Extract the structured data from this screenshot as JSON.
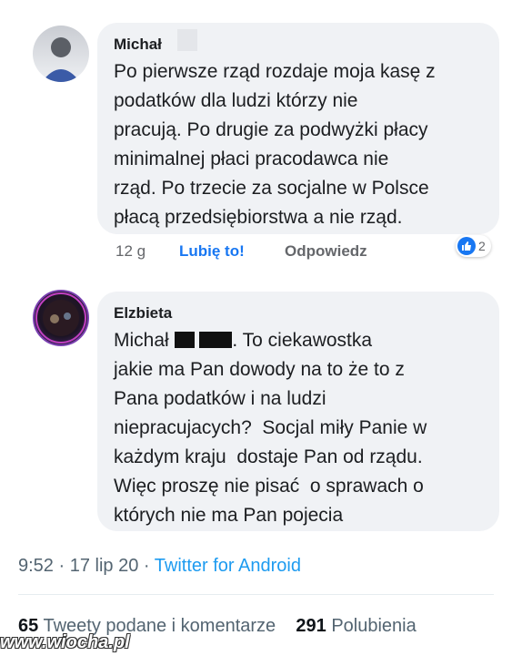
{
  "comment1": {
    "author": "Michał",
    "text": "Po pierwsze rząd rozdaje moja kasę z\npodatków dla ludzi którzy nie\npracują. Po drugie za podwyżki płacy\nminimalnej płaci pracodawca nie\nrząd. Po trzecie za socjalne w Polsce\npłacą przedsiębiorstwa a nie rząd.",
    "time": "12 g",
    "like_label": "Lubię to!",
    "reply_label": "Odpowiedz",
    "reaction_count": "2"
  },
  "comment2": {
    "author": "Elzbieta",
    "mention": "Michał",
    "text_after_mention": ". To ciekawostka\njakie ma Pan dowody na to że to z\nPana podatków i na ludzi\nniepracujacych?  Socjal miły Panie w\nkażdym kraju  dostaje Pan od rządu.\nWięc proszę nie pisać  o sprawach o\nktórych nie ma Pan pojecia"
  },
  "tweet_meta": {
    "time": "9:52",
    "date": "17 lip 20",
    "separator": " · ",
    "source": "Twitter for Android"
  },
  "stats": {
    "retweets_count": "65",
    "retweets_label": "Tweety podane i komentarze",
    "likes_count": "291",
    "likes_label": "Polubienia"
  },
  "watermark": "www.wiocha.pl",
  "colors": {
    "bubble": "#f0f2f5",
    "link_blue": "#1877f2",
    "twitter_blue": "#1d9bf0",
    "muted": "#65676b"
  }
}
